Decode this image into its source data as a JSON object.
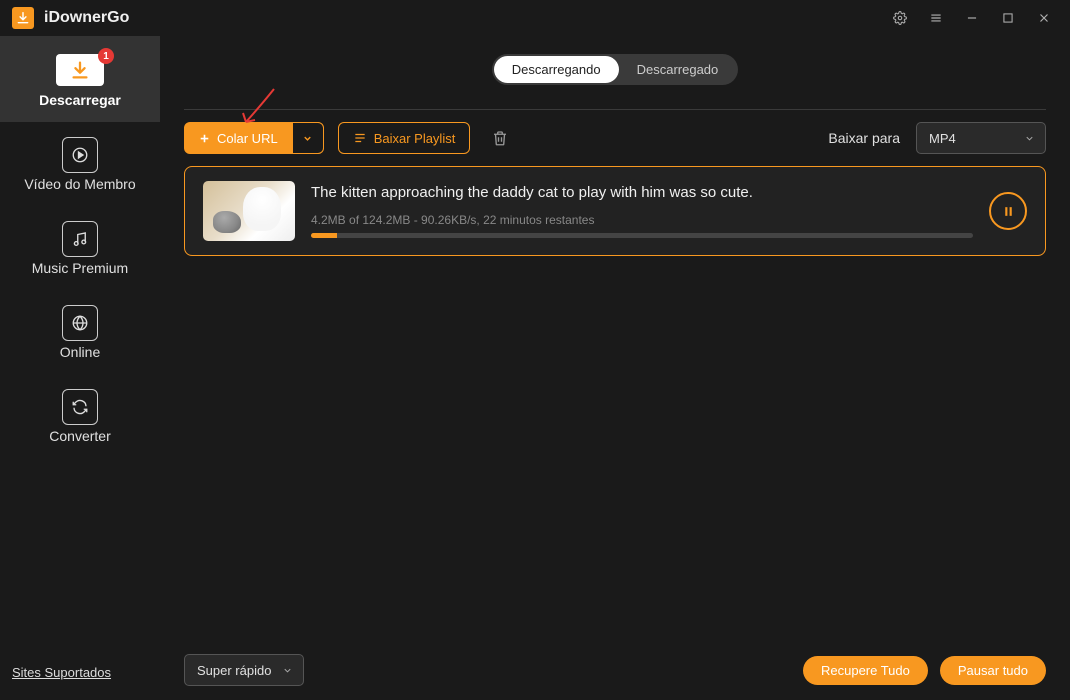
{
  "app": {
    "title": "iDownerGo"
  },
  "sidebar": {
    "items": [
      {
        "label": "Descarregar",
        "badge": "1"
      },
      {
        "label": "Vídeo do Membro"
      },
      {
        "label": "Music Premium"
      },
      {
        "label": "Online"
      },
      {
        "label": "Converter"
      }
    ],
    "footer_link": "Sites Suportados"
  },
  "tabs": {
    "active": "Descarregando",
    "inactive": "Descarregado"
  },
  "toolbar": {
    "paste_label": "Colar URL",
    "playlist_label": "Baixar Playlist",
    "download_to_label": "Baixar para",
    "format_value": "MP4"
  },
  "download": {
    "title": "The kitten approaching the daddy cat to play with him was so cute.",
    "meta": "4.2MB of 124.2MB -   90.26KB/s, 22 minutos restantes",
    "progress_percent": 4
  },
  "footer": {
    "speed_label": "Super rápido",
    "recover_label": "Recupere Tudo",
    "pause_all_label": "Pausar tudo"
  }
}
